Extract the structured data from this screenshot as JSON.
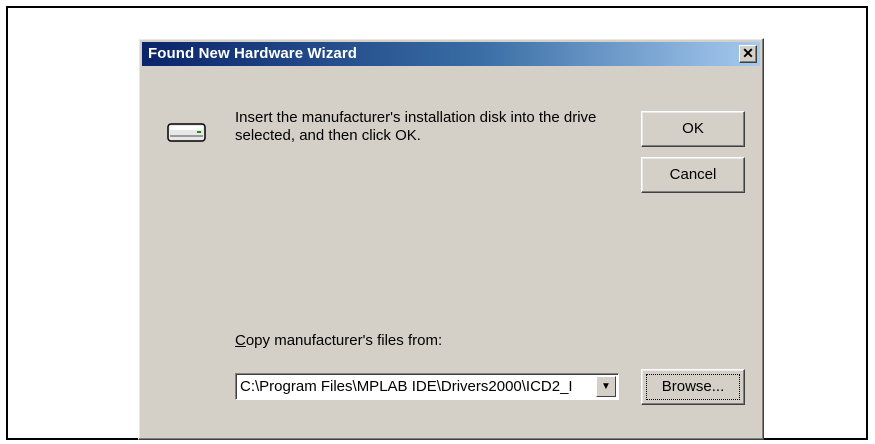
{
  "window": {
    "title": "Found New Hardware Wizard",
    "close_label": "✕",
    "icon": "close-icon"
  },
  "drive_icon": "disk-drive-icon",
  "message": "Insert the manufacturer's installation disk into the drive selected, and then click OK.",
  "buttons": {
    "ok": "OK",
    "cancel": "Cancel",
    "browse": "Browse..."
  },
  "copy_from": {
    "label": "Copy manufacturer's files from:",
    "value": "C:\\Program Files\\MPLAB IDE\\Drivers2000\\ICD2_I",
    "arrow": "▼"
  }
}
